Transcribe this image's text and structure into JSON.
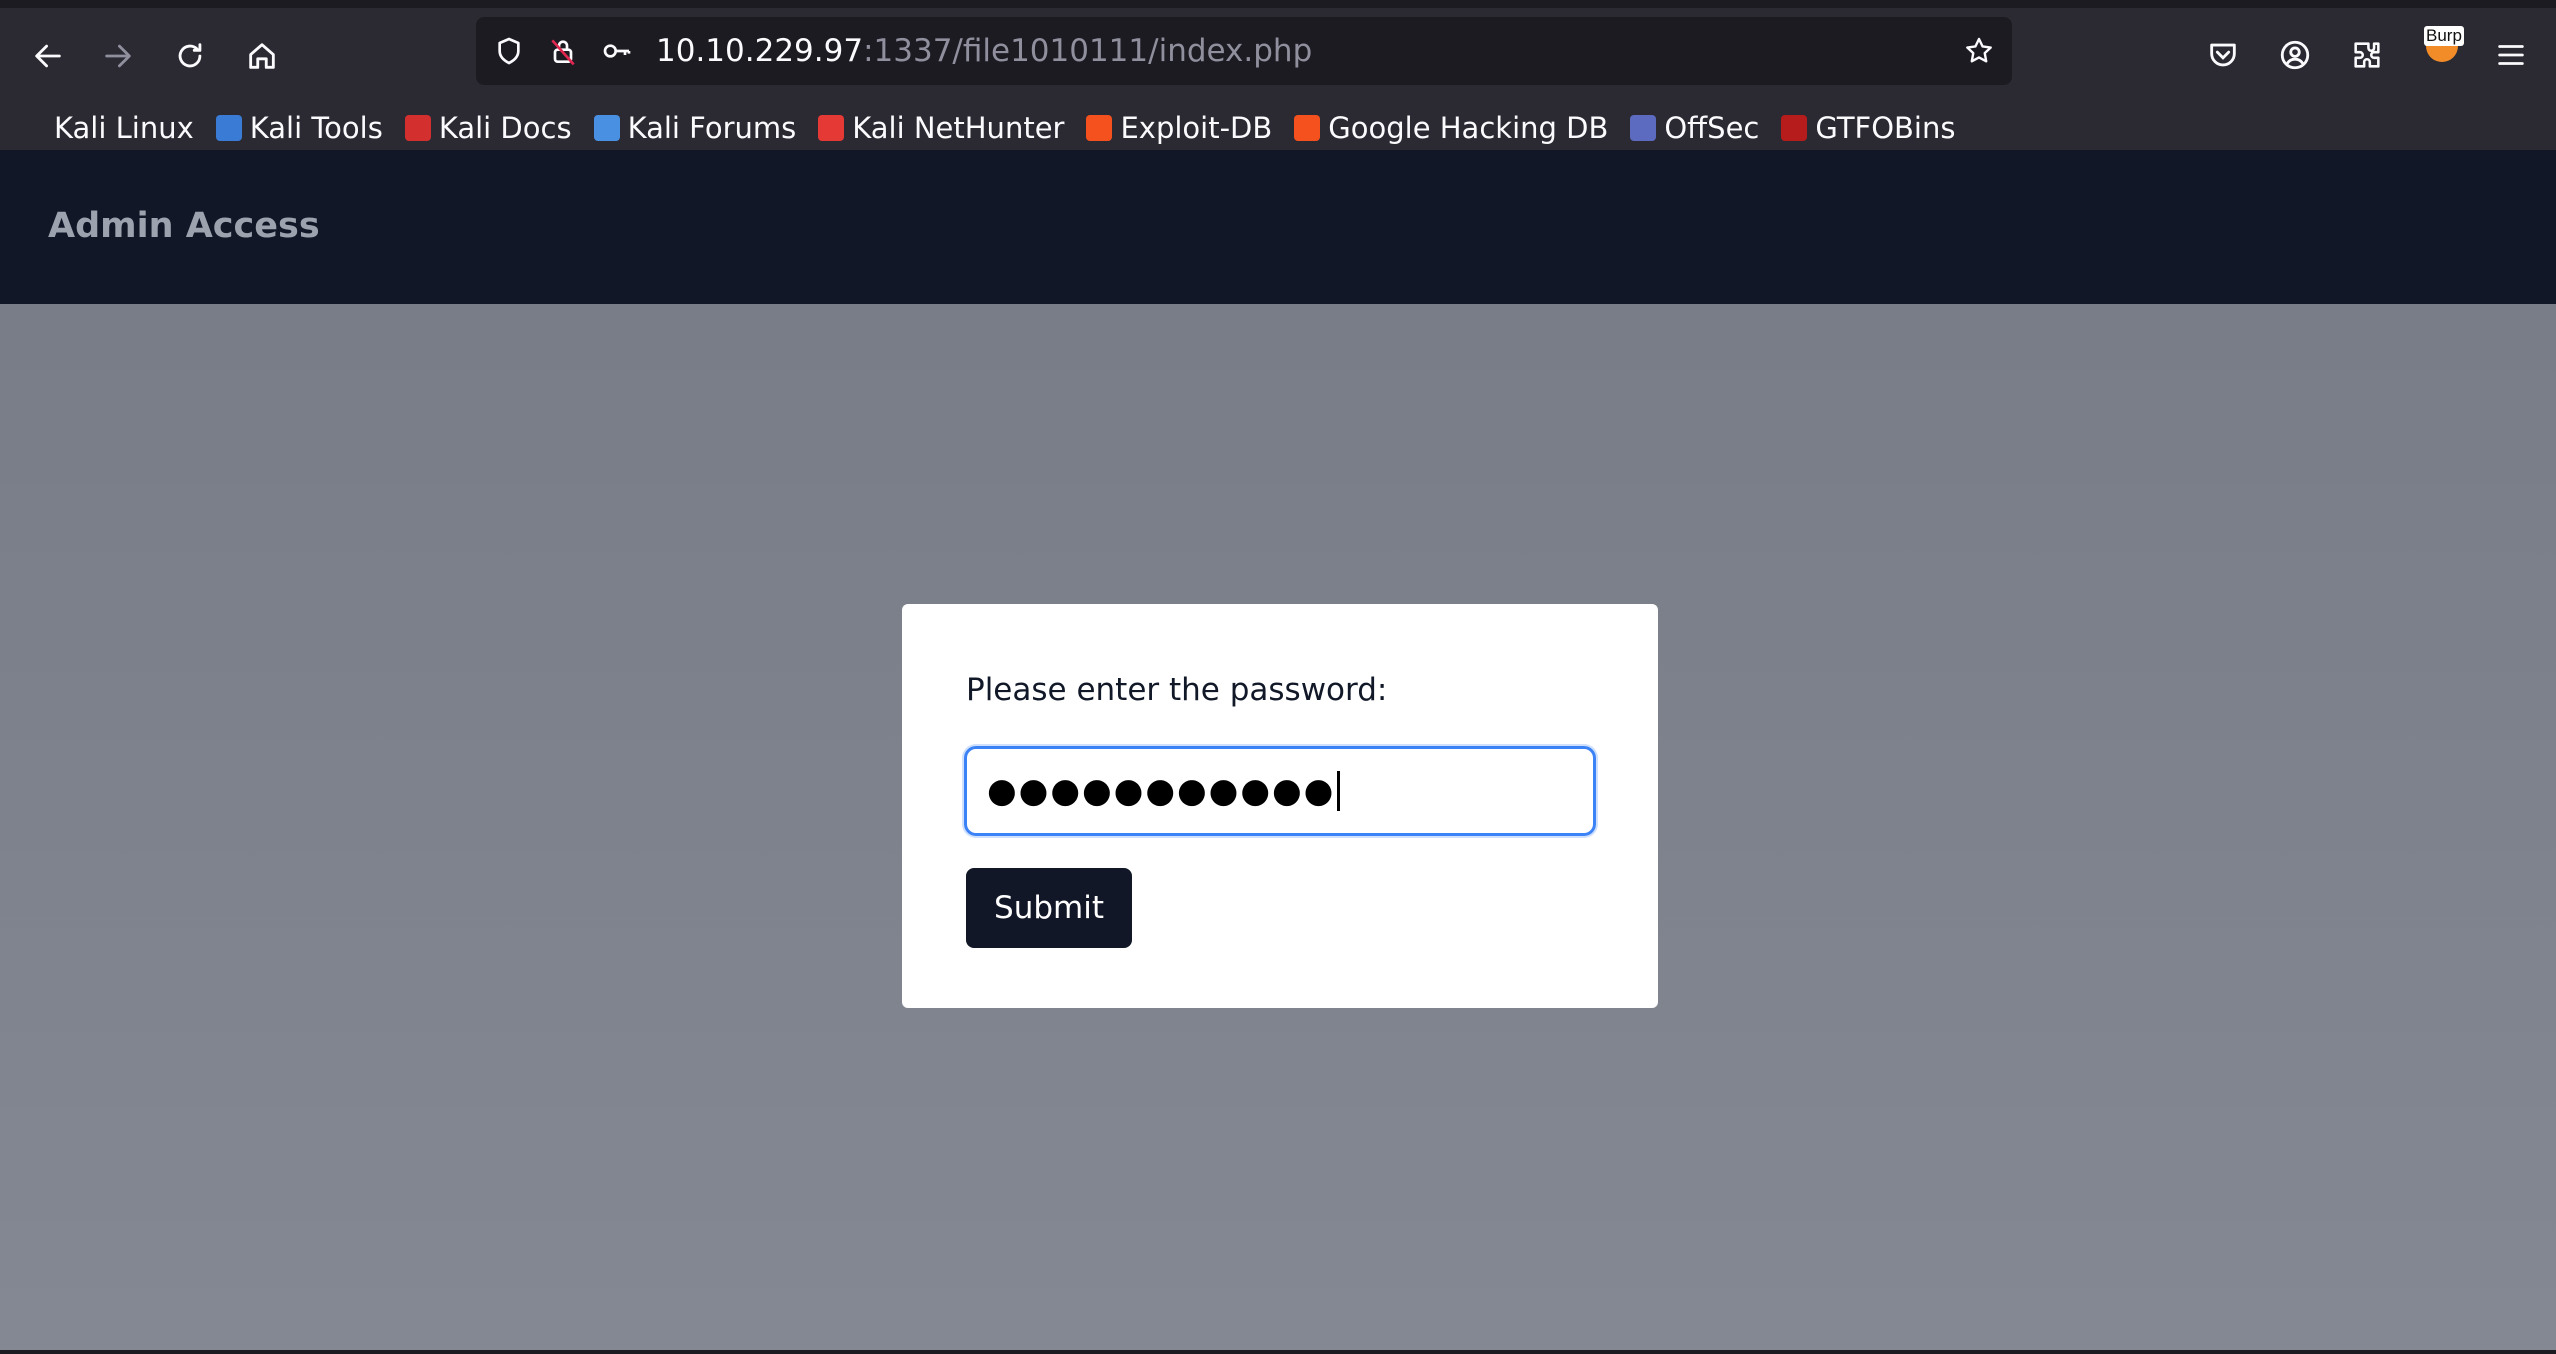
{
  "browser": {
    "url_host": "10.10.229.97",
    "url_rest": ":1337/file1010111/index.php",
    "toolbar_icons": [
      "back-arrow-icon",
      "forward-arrow-icon",
      "reload-icon",
      "home-icon",
      "shield-icon",
      "insecure-lock-icon",
      "key-icon",
      "bookmark-star-icon",
      "pocket-icon",
      "account-icon",
      "extensions-icon",
      "burp-extension-icon",
      "hamburger-menu-icon"
    ],
    "burp_badge": "Burp",
    "bookmarks": [
      {
        "label": "Kali Linux",
        "icon": "kali-dragon-icon",
        "color": "#2b2a33"
      },
      {
        "label": "Kali Tools",
        "icon": "kali-tools-icon",
        "color": "#3a7bd5"
      },
      {
        "label": "Kali Docs",
        "icon": "kali-docs-icon",
        "color": "#d32f2f"
      },
      {
        "label": "Kali Forums",
        "icon": "kali-forums-icon",
        "color": "#4a90e2"
      },
      {
        "label": "Kali NetHunter",
        "icon": "nethunter-icon",
        "color": "#e53935"
      },
      {
        "label": "Exploit-DB",
        "icon": "exploit-db-icon",
        "color": "#f4511e"
      },
      {
        "label": "Google Hacking DB",
        "icon": "ghdb-icon",
        "color": "#f4511e"
      },
      {
        "label": "OffSec",
        "icon": "offsec-icon",
        "color": "#5c6bc0"
      },
      {
        "label": "GTFOBins",
        "icon": "gtfobins-icon",
        "color": "#b71c1c"
      }
    ]
  },
  "site": {
    "title": "Admin Access"
  },
  "form": {
    "prompt": "Please enter the password:",
    "password_masked": "●●●●●●●●●●●",
    "submit_label": "Submit"
  },
  "colors": {
    "header_bg": "#111727",
    "page_bg": "#7d818b",
    "focus_border": "#3b82f6",
    "button_bg": "#111727"
  }
}
